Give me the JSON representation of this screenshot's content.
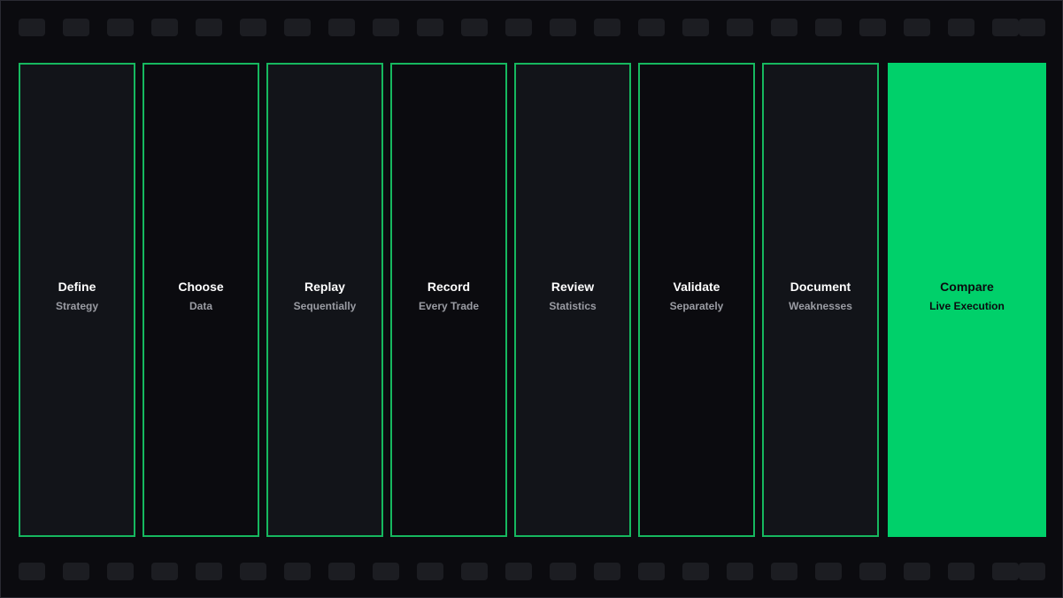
{
  "colors": {
    "background": "#0b0b0f",
    "sprocket_hole": "#1c1d22",
    "frame_border": "#16b85f",
    "frame_fill_a": "#121419",
    "frame_fill_b": "#0b0b0f",
    "active_fill": "#00d06a",
    "title_text": "#ffffff",
    "subtitle_text": "#9a9ca3",
    "active_text": "#0b0b0f"
  },
  "steps": [
    {
      "title": "Define",
      "subtitle": "Strategy",
      "active": false
    },
    {
      "title": "Choose",
      "subtitle": "Data",
      "active": false
    },
    {
      "title": "Replay",
      "subtitle": "Sequentially",
      "active": false
    },
    {
      "title": "Record",
      "subtitle": "Every Trade",
      "active": false
    },
    {
      "title": "Review",
      "subtitle": "Statistics",
      "active": false
    },
    {
      "title": "Validate",
      "subtitle": "Separately",
      "active": false
    },
    {
      "title": "Document",
      "subtitle": "Weaknesses",
      "active": false
    },
    {
      "title": "Compare",
      "subtitle": "Live Execution",
      "active": true
    }
  ]
}
